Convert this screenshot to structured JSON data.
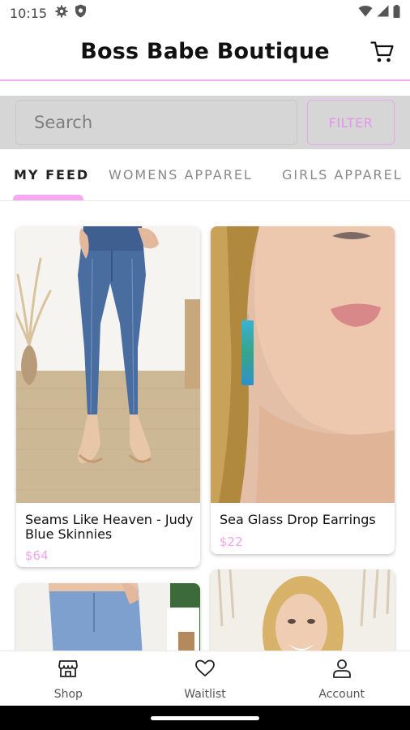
{
  "status_bar": {
    "time": "10:15",
    "left_icons": [
      "gear-icon",
      "shield-icon"
    ],
    "right_icons": [
      "wifi-icon",
      "signal-icon",
      "battery-icon"
    ]
  },
  "header": {
    "title": "Boss Babe Boutique",
    "cart_icon": "cart-icon"
  },
  "search": {
    "placeholder": "Search",
    "filter_label": "FILTER"
  },
  "tabs": [
    {
      "label": "MY FEED",
      "active": true
    },
    {
      "label": "WOMENS APPAREL",
      "active": false
    },
    {
      "label": "GIRLS APPAREL",
      "active": false
    }
  ],
  "products": [
    {
      "name": "Seams Like Heaven - Judy Blue Skinnies",
      "price": "$64"
    },
    {
      "name": "Sea Glass Drop Earrings",
      "price": "$22"
    },
    {
      "name": "",
      "price": ""
    },
    {
      "name": "",
      "price": ""
    }
  ],
  "bottom_nav": [
    {
      "label": "Shop",
      "icon": "shop-icon"
    },
    {
      "label": "Waitlist",
      "icon": "heart-icon"
    },
    {
      "label": "Account",
      "icon": "account-icon"
    }
  ],
  "colors": {
    "accent": "#f4a9f0",
    "price": "#f0a4ef",
    "search_bg": "#d6d6d6"
  }
}
